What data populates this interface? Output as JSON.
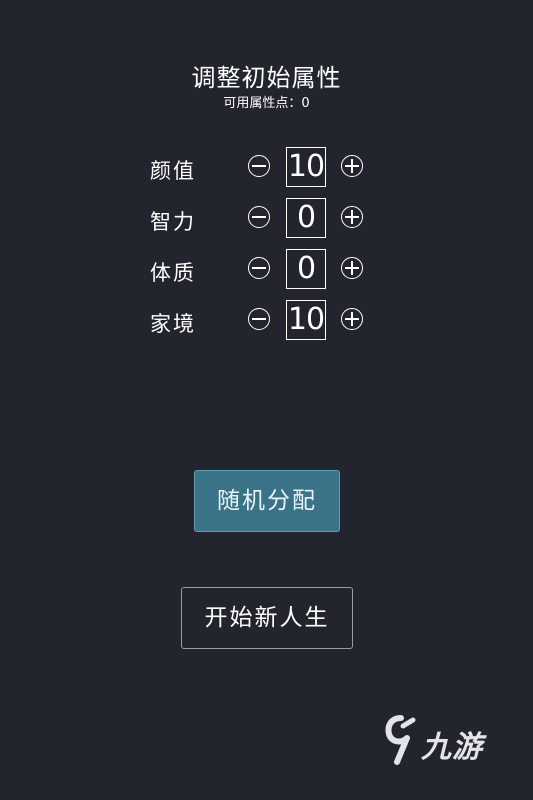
{
  "header": {
    "title": "调整初始属性",
    "points_label": "可用属性点：",
    "points_value": "0"
  },
  "attributes": [
    {
      "label": "颜值",
      "value": "10"
    },
    {
      "label": "智力",
      "value": "0"
    },
    {
      "label": "体质",
      "value": "0"
    },
    {
      "label": "家境",
      "value": "10"
    }
  ],
  "buttons": {
    "random_label": "随机分配",
    "start_label": "开始新人生"
  },
  "watermark": {
    "text": "九游",
    "icon": "nine-game-logo-icon"
  },
  "colors": {
    "background": "#23252e",
    "accent_button": "#3a7388",
    "text": "#ffffff"
  }
}
